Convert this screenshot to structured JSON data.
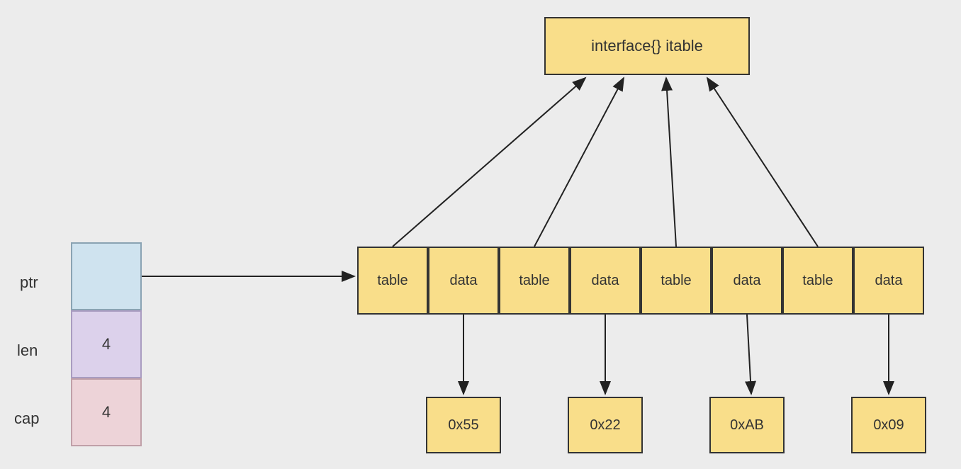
{
  "itable": {
    "label": "interface{} itable"
  },
  "slice": {
    "ptr": {
      "label": "ptr"
    },
    "len": {
      "label": "len",
      "value": "4"
    },
    "cap": {
      "label": "cap",
      "value": "4"
    }
  },
  "cells": [
    {
      "label": "table"
    },
    {
      "label": "data"
    },
    {
      "label": "table"
    },
    {
      "label": "data"
    },
    {
      "label": "table"
    },
    {
      "label": "data"
    },
    {
      "label": "table"
    },
    {
      "label": "data"
    }
  ],
  "values": [
    {
      "label": "0x55"
    },
    {
      "label": "0x22"
    },
    {
      "label": "0xAB"
    },
    {
      "label": "0x09"
    }
  ]
}
